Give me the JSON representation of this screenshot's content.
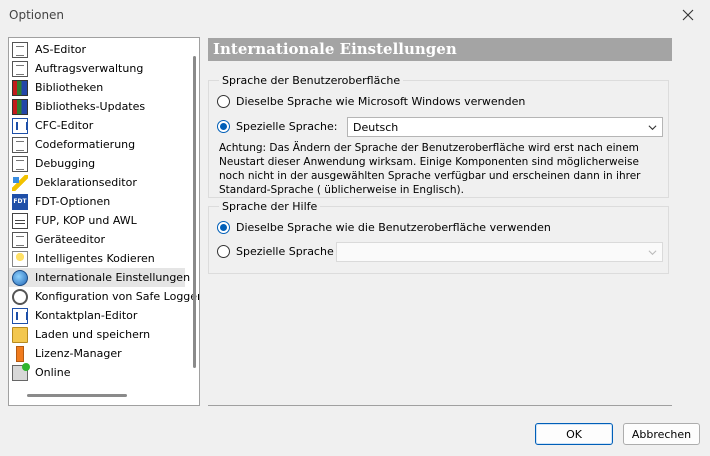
{
  "window": {
    "title": "Optionen"
  },
  "tree": {
    "items": [
      {
        "label": "AS-Editor",
        "icon": "as-editor-icon",
        "cls": "ic-doc"
      },
      {
        "label": "Auftragsverwaltung",
        "icon": "clipboard-icon",
        "cls": "ic-doc"
      },
      {
        "label": "Bibliotheken",
        "icon": "books-icon",
        "cls": "ic-books"
      },
      {
        "label": "Bibliotheks-Updates",
        "icon": "books-update-icon",
        "cls": "ic-books"
      },
      {
        "label": "CFC-Editor",
        "icon": "cfc-editor-icon",
        "cls": "ic-kontakt"
      },
      {
        "label": "Codeformatierung",
        "icon": "code-format-icon",
        "cls": "ic-doc"
      },
      {
        "label": "Debugging",
        "icon": "debug-icon",
        "cls": "ic-doc"
      },
      {
        "label": "Deklarationseditor",
        "icon": "declaration-editor-icon",
        "cls": "ic-pencil"
      },
      {
        "label": "FDT-Optionen",
        "icon": "fdt-icon",
        "cls": "ic-fdt",
        "badge": "FDT"
      },
      {
        "label": "FUP, KOP und AWL",
        "icon": "fup-icon",
        "cls": "ic-fup"
      },
      {
        "label": "Geräteeditor",
        "icon": "device-editor-icon",
        "cls": "ic-doc"
      },
      {
        "label": "Intelligentes Kodieren",
        "icon": "smart-coding-icon",
        "cls": "ic-bulb"
      },
      {
        "label": "Internationale Einstellungen",
        "icon": "globe-icon",
        "cls": "ic-globe",
        "selected": true
      },
      {
        "label": "Konfiguration von Safe Logger",
        "icon": "safe-logger-icon",
        "cls": "ic-safe"
      },
      {
        "label": "Kontaktplan-Editor",
        "icon": "ladder-editor-icon",
        "cls": "ic-kontakt"
      },
      {
        "label": "Laden und speichern",
        "icon": "folder-open-icon",
        "cls": "ic-folder"
      },
      {
        "label": "Lizenz-Manager",
        "icon": "license-icon",
        "cls": "ic-orange"
      },
      {
        "label": "Online",
        "icon": "online-icon",
        "cls": "ic-online"
      }
    ]
  },
  "panel": {
    "header": "Internationale Einstellungen",
    "ui_language": {
      "legend": "Sprache der Benutzeroberfläche",
      "option_windows": "Dieselbe Sprache wie Microsoft Windows verwenden",
      "option_special": "Spezielle Sprache:",
      "selected_language": "Deutsch",
      "note": "Achtung: Das Ändern der Sprache der Benutzeroberfläche wird erst nach einem Neustart dieser Anwendung wirksam. Einige Komponenten sind möglicherweise noch nicht in der ausgewählten Sprache verfügbar und erscheinen dann in ihrer Standard-Sprache ( üblicherweise in Englisch)."
    },
    "help_language": {
      "legend": "Sprache der Hilfe",
      "option_same": "Dieselbe Sprache wie die Benutzeroberfläche verwenden",
      "option_special": "Spezielle Sprache",
      "selected_language": ""
    }
  },
  "buttons": {
    "ok": "OK",
    "cancel": "Abbrechen"
  },
  "colors": {
    "accent": "#005fb8",
    "header_bg": "#a4a4a4"
  }
}
